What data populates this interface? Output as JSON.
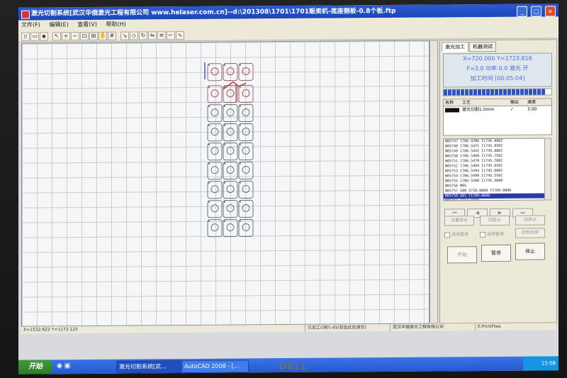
{
  "window": {
    "title": "激光切割系统[武汉华俄激光工程有限公司 www.helaser.com.cn]--d:\\201308\\1701\\1701贩卖机-底座侧板-0.8个板.ftp",
    "controls": [
      "_",
      "□",
      "×"
    ]
  },
  "menu": [
    "文件(F)",
    "编辑(E)",
    "查看(V)",
    "帮助(H)"
  ],
  "toolbar_icons": [
    "new-icon",
    "open-icon",
    "save-icon",
    "select-icon",
    "zoom-in-icon",
    "zoom-out-icon",
    "zoom-window-icon",
    "zoom-fit-icon",
    "pan-icon",
    "grid-icon",
    "pointer-icon",
    "node-edit-icon",
    "rotate-icon",
    "mirror-icon",
    "array-icon",
    "lead-icon",
    "path-icon"
  ],
  "right_panel": {
    "tabs": [
      "激光加工",
      "机器测试"
    ],
    "status": {
      "coords": "X=720.000  Y=1723.818",
      "power": "F=3.0  功率 0.0  激光 开",
      "time": "加工时间 [00:05:04]"
    },
    "progress_fraction": 0.95,
    "layer_table": {
      "headers": [
        "名称",
        "工艺",
        "输出",
        "速度"
      ],
      "rows": [
        [
          "激光切割1.0mm",
          "✓",
          "3.00"
        ]
      ]
    },
    "code_lines": [
      "N05747 1706.9396 I1745.9002",
      "N05748 1706.5421 I1745.8502",
      "N05749 1706.5442 I1745.8002",
      "N05750 1706.5460 I1745.7502",
      "N05751 1706.5478 I1745.7002",
      "N05752 1706.5484 I1745.6501",
      "N05753 1706.5494 I1745.6001",
      "N05754 1706.5499 I1745.5501",
      "N05755 1706.5500 I1745.5000",
      "N05756 M05",
      "N05757 G00 X720.0000 Y1709.0000",
      "N05758 G01 Y1709.0000",
      "N05759 X714.0000"
    ],
    "selected_line_index": 11,
    "nav_buttons": [
      "⏮",
      "◀",
      "▶",
      "⏭"
    ],
    "aux_buttons": [
      "设置原点",
      "回原点",
      "回原点",
      "自动暂停",
      "连续暂停",
      "回到机原"
    ],
    "checkboxes": [
      "连续暂停",
      "连续暂停"
    ],
    "main_buttons": {
      "start": "开始",
      "pause": "暂停",
      "stop": "停止"
    }
  },
  "statusbar": {
    "coords": "X=1532.622  Y=1172.125",
    "state": "已加工(0秒):4S(双击此处清空)",
    "company": "武汉华俄激光工程有限公司",
    "extra": "E:PrintFiles"
  },
  "taskbar": {
    "start": "开始",
    "tasks": [
      "激光切割系统[武...",
      "AutoCAD 2008 - [..."
    ],
    "clock": "15:08"
  },
  "monitor_brand": "DELL"
}
